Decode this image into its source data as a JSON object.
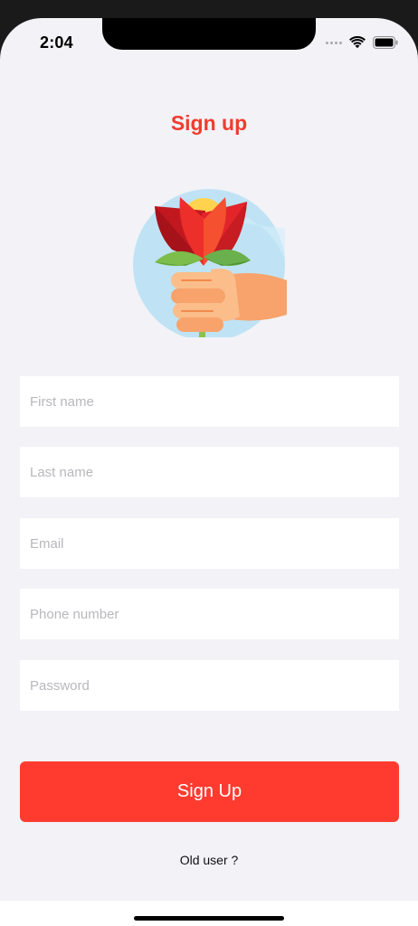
{
  "status_bar": {
    "time": "2:04",
    "icons": [
      "cellular-dots-icon",
      "wifi-icon",
      "battery-icon"
    ]
  },
  "page": {
    "title": "Sign up",
    "hero_icon": "hand-holding-flower-icon"
  },
  "form": {
    "first_name_placeholder": "First name",
    "last_name_placeholder": "Last name",
    "email_placeholder": "Email",
    "phone_placeholder": "Phone number",
    "password_placeholder": "Password",
    "submit_label": "Sign Up"
  },
  "footer": {
    "old_user_link": "Old user ?"
  },
  "colors": {
    "accent": "#ff3b30",
    "title": "#f03c2e",
    "background": "#f2f2f7",
    "field_bg": "#ffffff"
  }
}
